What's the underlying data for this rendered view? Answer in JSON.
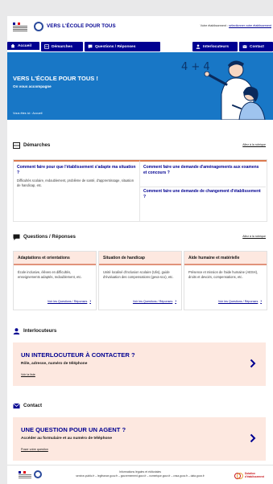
{
  "header": {
    "site_title": "VERS L'ÉCOLE POUR TOUS",
    "etablissement_label": "Votre établissement :",
    "etablissement_link": "sélectionner votre établissement"
  },
  "nav": {
    "items": [
      {
        "label": "Accueil",
        "icon": "home-icon"
      },
      {
        "label": "Démarches",
        "icon": "document-icon"
      },
      {
        "label": "Questions / Réponses",
        "icon": "chat-icon"
      },
      {
        "label": "Interlocuteurs",
        "icon": "user-icon"
      },
      {
        "label": "Contact",
        "icon": "mail-icon"
      }
    ]
  },
  "hero": {
    "title": "VERS L'ÉCOLE POUR TOUS !",
    "subtitle": "On vous accompagne",
    "breadcrumb": "Vous êtes ici : Accueil",
    "chalk_text": "4 + 4",
    "bg_color": "#1877c6"
  },
  "demarches": {
    "title": "Démarches",
    "see_all": "Allez à la rubrique",
    "items": [
      {
        "question": "Comment faire pour que l'établissement s'adapte ma situation ?",
        "desc": "Difficultés scolaire, redoublement, problème de santé, d'apprentissage, situation de handicap, etc."
      },
      {
        "question": "Comment faire une demande d'aménagements aux examens et concours ?",
        "desc": ""
      },
      {
        "question": "Comment faire une demande de changement d'établissement ?",
        "desc": ""
      }
    ]
  },
  "qr": {
    "title": "Questions / Réponses",
    "see_all": "Allez à la rubrique",
    "cards": [
      {
        "title": "Adaptations et orientations",
        "body": "École inclusive, élèves en difficultés, enseignements adaptés, redoublement, etc.",
        "more": "Voir les Questions / Réponses"
      },
      {
        "title": "Situation de handicap",
        "body": "Unité localisé d'inclusion scolaire (Ulis), guide d'évaluation des compensations (geva-sco), etc.",
        "more": "Voir les Questions / Réponses"
      },
      {
        "title": "Aide humaine et matérielle",
        "body": "Présence et mission de l'aide humaine (AESH), droits et devoirs, compensations, etc.",
        "more": "Voir les Questions / Réponses"
      }
    ]
  },
  "interlocuteurs": {
    "title": "Interlocuteurs",
    "cta_big": "UN INTERLOCUTEUR À CONTACTER ?",
    "cta_small": "Rôle, adresse, numéro de téléphone",
    "cta_link": "Voir la liste"
  },
  "contact": {
    "title": "Contact",
    "cta_big": "UNE QUESTION POUR UN AGENT ?",
    "cta_small": "Accéder au formulaire et au numéro de téléphone",
    "cta_link": "Poser votre question"
  },
  "footer": {
    "line1": "Informations légales et éditoriales",
    "line2": "service-public.fr – legifrance.gouv.fr – gouvernement.gouv.fr – numerique.gouv.fr – cnsa.gouv.fr – data.gouv.fr",
    "right_line1": "Dotation",
    "right_line2": "d'établissement"
  },
  "colors": {
    "brand_blue": "#000091",
    "accent": "#dc7a4f",
    "pink": "#fde8e0"
  }
}
